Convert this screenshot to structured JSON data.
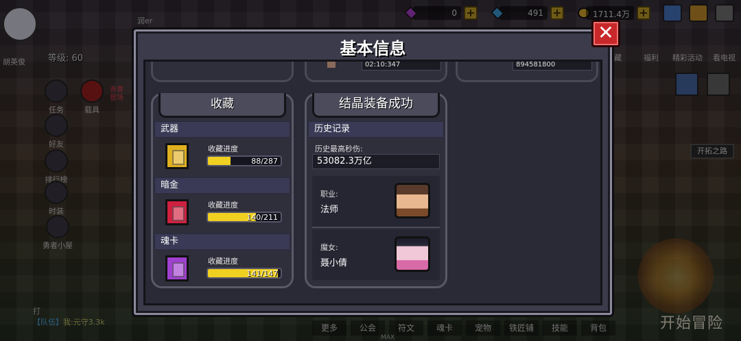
{
  "hud": {
    "resources": [
      {
        "icon": "purple-gem-icon",
        "value": "0",
        "color": "#b040d0"
      },
      {
        "icon": "blue-diamond-icon",
        "value": "491",
        "color": "#40a0e0"
      },
      {
        "icon": "gold-coin-icon",
        "value": "1711.4万",
        "color": "#e0b030"
      }
    ],
    "plus_label": "+",
    "level_text": "等级: 60",
    "player_name": "胡英俊",
    "left_menu": [
      "任务",
      "载具",
      "好友",
      "排行榜",
      "时装",
      "勇者小屋"
    ],
    "red_car_label": "赤青登场",
    "right_menu": [
      "女珍藏",
      "福利",
      "精彩活动",
      "看电视"
    ],
    "explore_label": "开拓之路",
    "start_label": "开始冒险",
    "bottom_tabs": [
      "更多",
      "公会",
      "符文",
      "魂卡",
      "宠物",
      "铁匠铺",
      "技能",
      "背包"
    ],
    "max_label": "MAX",
    "chat": {
      "title": "打",
      "team": "【队伍】",
      "speaker": "我:",
      "message": "元守3.3k"
    },
    "top_name": "润er"
  },
  "modal": {
    "title": "基本信息",
    "close_label": "✕",
    "top_row_values": [
      "02:10:347",
      "894581800"
    ],
    "collection": {
      "title": "收藏",
      "progress_label": "收藏进度",
      "sections": [
        {
          "name": "武器",
          "progress_text": "88/287",
          "fraction": 0.307,
          "icon_color": "#e0b020"
        },
        {
          "name": "暗金",
          "progress_text": "140/211",
          "fraction": 0.664,
          "icon_color": "#d02040"
        },
        {
          "name": "魂卡",
          "progress_text": "141/147",
          "fraction": 0.959,
          "icon_color": "#a040d0"
        }
      ]
    },
    "record": {
      "title": "结晶装备成功",
      "section": "历史记录",
      "dps_label": "历史最高秒伤:",
      "dps_value": "53082.3万亿",
      "class_label": "职业:",
      "class_value": "法师",
      "pet_label": "魔女:",
      "pet_value": "聂小倩"
    }
  }
}
